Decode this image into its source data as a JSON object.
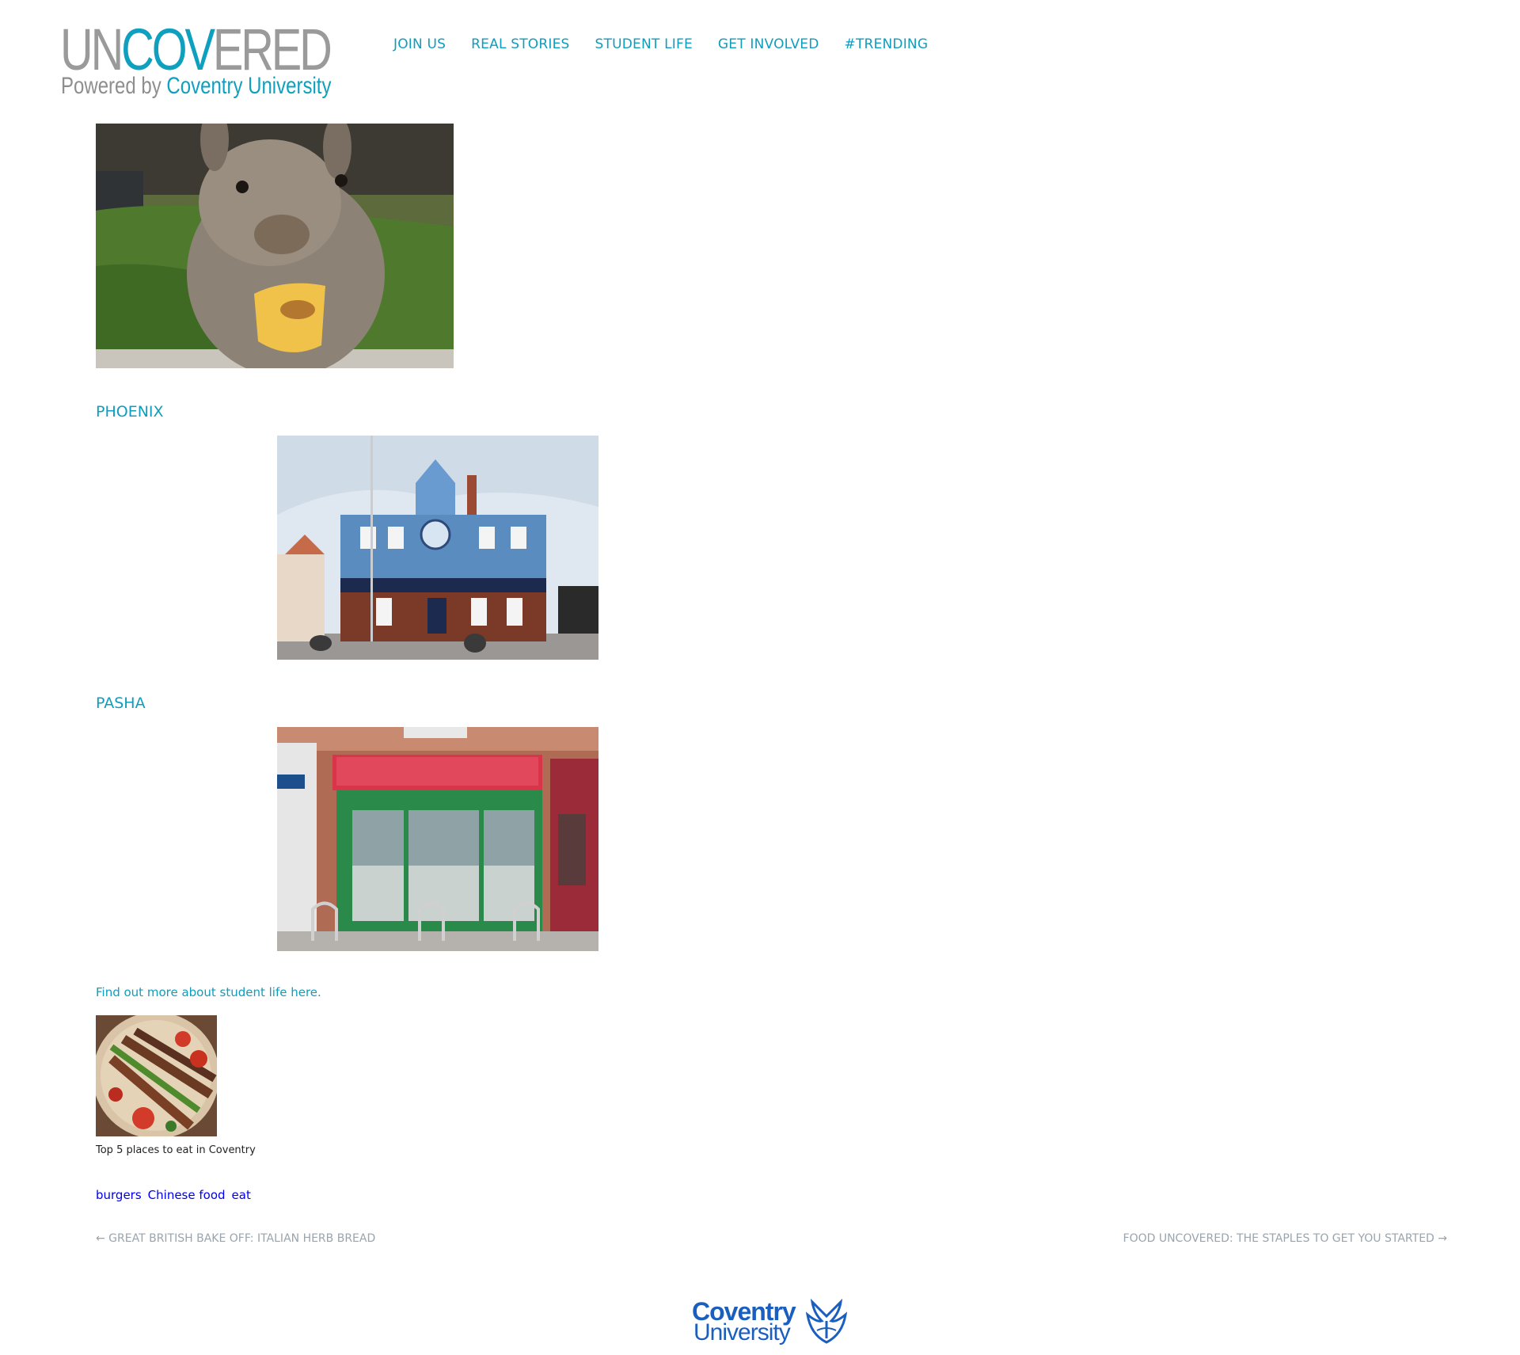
{
  "header": {
    "logo": {
      "word_part1": "UN",
      "word_part2": "COV",
      "word_part3": "ERED",
      "powered_by": "Powered by ",
      "university": "Coventry University"
    },
    "nav": [
      {
        "label": "JOIN US"
      },
      {
        "label": "REAL STORIES"
      },
      {
        "label": "STUDENT LIFE"
      },
      {
        "label": "GET INVOLVED"
      },
      {
        "label": "#TRENDING"
      }
    ]
  },
  "article": {
    "sections": [
      {
        "heading": "PHOENIX"
      },
      {
        "heading": "PASHA"
      }
    ],
    "find_more_link": "Find out more about student life here.",
    "related": {
      "caption": "Top 5 places to eat in Coventry"
    },
    "tags": [
      "burgers",
      "Chinese food",
      "eat"
    ],
    "pagination": {
      "prev": "← GREAT BRITISH BAKE OFF: ITALIAN HERB BREAD",
      "next": "FOOD UNCOVERED: THE STAPLES TO GET YOU STARTED →"
    }
  },
  "footer": {
    "logo_line1": "Coventry",
    "logo_line2": "University"
  },
  "colors": {
    "accent": "#0f9dbd",
    "logo_grey": "#9a9a9a",
    "pagination_grey": "#9aa4ad",
    "footer_blue": "#1a5fbf"
  }
}
